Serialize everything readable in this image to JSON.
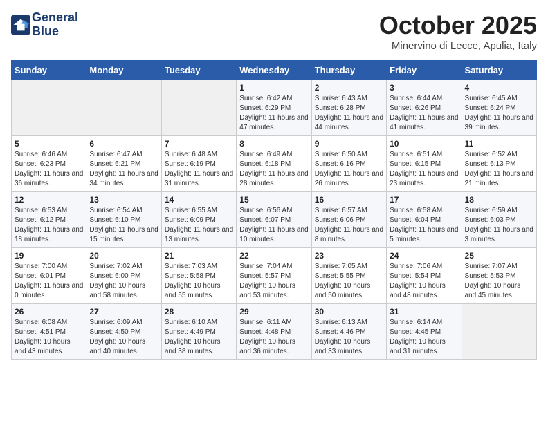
{
  "header": {
    "logo_line1": "General",
    "logo_line2": "Blue",
    "month": "October 2025",
    "location": "Minervino di Lecce, Apulia, Italy"
  },
  "days_of_week": [
    "Sunday",
    "Monday",
    "Tuesday",
    "Wednesday",
    "Thursday",
    "Friday",
    "Saturday"
  ],
  "weeks": [
    [
      {
        "day": "",
        "info": ""
      },
      {
        "day": "",
        "info": ""
      },
      {
        "day": "",
        "info": ""
      },
      {
        "day": "1",
        "info": "Sunrise: 6:42 AM\nSunset: 6:29 PM\nDaylight: 11 hours and 47 minutes."
      },
      {
        "day": "2",
        "info": "Sunrise: 6:43 AM\nSunset: 6:28 PM\nDaylight: 11 hours and 44 minutes."
      },
      {
        "day": "3",
        "info": "Sunrise: 6:44 AM\nSunset: 6:26 PM\nDaylight: 11 hours and 41 minutes."
      },
      {
        "day": "4",
        "info": "Sunrise: 6:45 AM\nSunset: 6:24 PM\nDaylight: 11 hours and 39 minutes."
      }
    ],
    [
      {
        "day": "5",
        "info": "Sunrise: 6:46 AM\nSunset: 6:23 PM\nDaylight: 11 hours and 36 minutes."
      },
      {
        "day": "6",
        "info": "Sunrise: 6:47 AM\nSunset: 6:21 PM\nDaylight: 11 hours and 34 minutes."
      },
      {
        "day": "7",
        "info": "Sunrise: 6:48 AM\nSunset: 6:19 PM\nDaylight: 11 hours and 31 minutes."
      },
      {
        "day": "8",
        "info": "Sunrise: 6:49 AM\nSunset: 6:18 PM\nDaylight: 11 hours and 28 minutes."
      },
      {
        "day": "9",
        "info": "Sunrise: 6:50 AM\nSunset: 6:16 PM\nDaylight: 11 hours and 26 minutes."
      },
      {
        "day": "10",
        "info": "Sunrise: 6:51 AM\nSunset: 6:15 PM\nDaylight: 11 hours and 23 minutes."
      },
      {
        "day": "11",
        "info": "Sunrise: 6:52 AM\nSunset: 6:13 PM\nDaylight: 11 hours and 21 minutes."
      }
    ],
    [
      {
        "day": "12",
        "info": "Sunrise: 6:53 AM\nSunset: 6:12 PM\nDaylight: 11 hours and 18 minutes."
      },
      {
        "day": "13",
        "info": "Sunrise: 6:54 AM\nSunset: 6:10 PM\nDaylight: 11 hours and 15 minutes."
      },
      {
        "day": "14",
        "info": "Sunrise: 6:55 AM\nSunset: 6:09 PM\nDaylight: 11 hours and 13 minutes."
      },
      {
        "day": "15",
        "info": "Sunrise: 6:56 AM\nSunset: 6:07 PM\nDaylight: 11 hours and 10 minutes."
      },
      {
        "day": "16",
        "info": "Sunrise: 6:57 AM\nSunset: 6:06 PM\nDaylight: 11 hours and 8 minutes."
      },
      {
        "day": "17",
        "info": "Sunrise: 6:58 AM\nSunset: 6:04 PM\nDaylight: 11 hours and 5 minutes."
      },
      {
        "day": "18",
        "info": "Sunrise: 6:59 AM\nSunset: 6:03 PM\nDaylight: 11 hours and 3 minutes."
      }
    ],
    [
      {
        "day": "19",
        "info": "Sunrise: 7:00 AM\nSunset: 6:01 PM\nDaylight: 11 hours and 0 minutes."
      },
      {
        "day": "20",
        "info": "Sunrise: 7:02 AM\nSunset: 6:00 PM\nDaylight: 10 hours and 58 minutes."
      },
      {
        "day": "21",
        "info": "Sunrise: 7:03 AM\nSunset: 5:58 PM\nDaylight: 10 hours and 55 minutes."
      },
      {
        "day": "22",
        "info": "Sunrise: 7:04 AM\nSunset: 5:57 PM\nDaylight: 10 hours and 53 minutes."
      },
      {
        "day": "23",
        "info": "Sunrise: 7:05 AM\nSunset: 5:55 PM\nDaylight: 10 hours and 50 minutes."
      },
      {
        "day": "24",
        "info": "Sunrise: 7:06 AM\nSunset: 5:54 PM\nDaylight: 10 hours and 48 minutes."
      },
      {
        "day": "25",
        "info": "Sunrise: 7:07 AM\nSunset: 5:53 PM\nDaylight: 10 hours and 45 minutes."
      }
    ],
    [
      {
        "day": "26",
        "info": "Sunrise: 6:08 AM\nSunset: 4:51 PM\nDaylight: 10 hours and 43 minutes."
      },
      {
        "day": "27",
        "info": "Sunrise: 6:09 AM\nSunset: 4:50 PM\nDaylight: 10 hours and 40 minutes."
      },
      {
        "day": "28",
        "info": "Sunrise: 6:10 AM\nSunset: 4:49 PM\nDaylight: 10 hours and 38 minutes."
      },
      {
        "day": "29",
        "info": "Sunrise: 6:11 AM\nSunset: 4:48 PM\nDaylight: 10 hours and 36 minutes."
      },
      {
        "day": "30",
        "info": "Sunrise: 6:13 AM\nSunset: 4:46 PM\nDaylight: 10 hours and 33 minutes."
      },
      {
        "day": "31",
        "info": "Sunrise: 6:14 AM\nSunset: 4:45 PM\nDaylight: 10 hours and 31 minutes."
      },
      {
        "day": "",
        "info": ""
      }
    ]
  ]
}
